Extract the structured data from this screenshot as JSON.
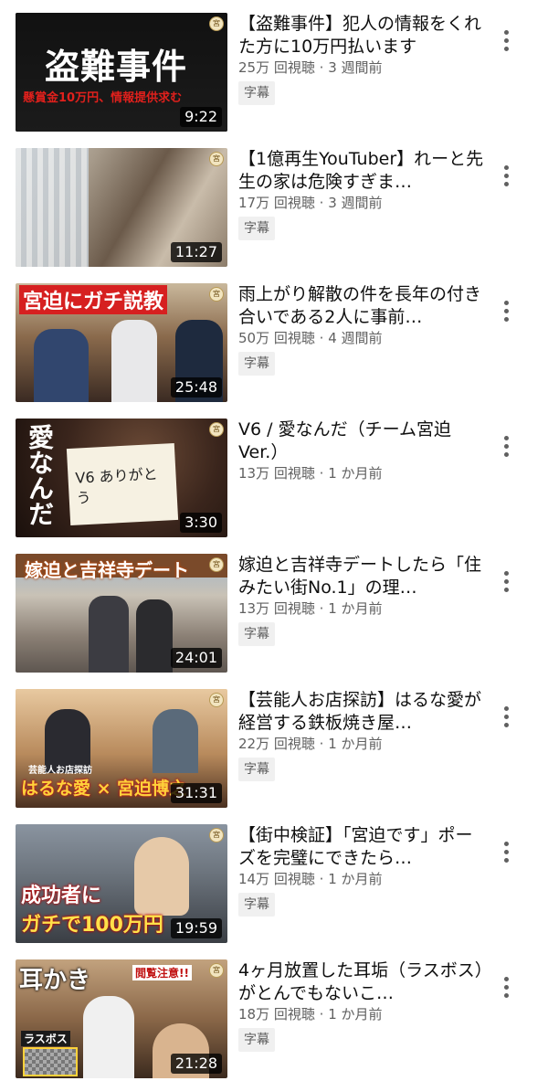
{
  "videos": [
    {
      "title": "【盗難事件】犯人の情報をくれた方に10万円払います",
      "views": "25万 回視聴",
      "age": "3 週間前",
      "badge": "字幕",
      "duration": "9:22",
      "thumb_text": [
        "盗難事件",
        "懸賞金10万円、情報提供求む"
      ]
    },
    {
      "title": "【1億再生YouTuber】れーと先生の家は危険すぎま…",
      "views": "17万 回視聴",
      "age": "3 週間前",
      "badge": "字幕",
      "duration": "11:27",
      "thumb_text": []
    },
    {
      "title": "雨上がり解散の件を長年の付き合いである2人に事前…",
      "views": "50万 回視聴",
      "age": "4 週間前",
      "badge": "字幕",
      "duration": "25:48",
      "thumb_text": [
        "宮迫にガチ説教"
      ]
    },
    {
      "title": "V6 / 愛なんだ（チーム宮迫Ver.）",
      "views": "13万 回視聴",
      "age": "1 か月前",
      "badge": "",
      "duration": "3:30",
      "thumb_text": [
        "愛なんだ",
        "V6 ありがとう"
      ]
    },
    {
      "title": "嫁迫と吉祥寺デートしたら「住みたい街No.1」の理…",
      "views": "13万 回視聴",
      "age": "1 か月前",
      "badge": "字幕",
      "duration": "24:01",
      "thumb_text": [
        "嫁迫と吉祥寺デート"
      ]
    },
    {
      "title": "【芸能人お店探訪】はるな愛が経営する鉄板焼き屋…",
      "views": "22万 回視聴",
      "age": "1 か月前",
      "badge": "字幕",
      "duration": "31:31",
      "thumb_text": [
        "芸能人お店探訪",
        "はるな愛 × 宮迫博之"
      ]
    },
    {
      "title": "【街中検証】「宮迫です」ポーズを完璧にできたら…",
      "views": "14万 回視聴",
      "age": "1 か月前",
      "badge": "字幕",
      "duration": "19:59",
      "thumb_text": [
        "成功者に",
        "ガチで100万円"
      ]
    },
    {
      "title": "4ヶ月放置した耳垢（ラスボス）がとんでもないこ…",
      "views": "18万 回視聴",
      "age": "1 か月前",
      "badge": "字幕",
      "duration": "21:28",
      "thumb_text": [
        "耳かき",
        "閲覧注意!!",
        "ラスボス"
      ]
    }
  ],
  "meta_separator": "·",
  "channel_badge": "宮"
}
